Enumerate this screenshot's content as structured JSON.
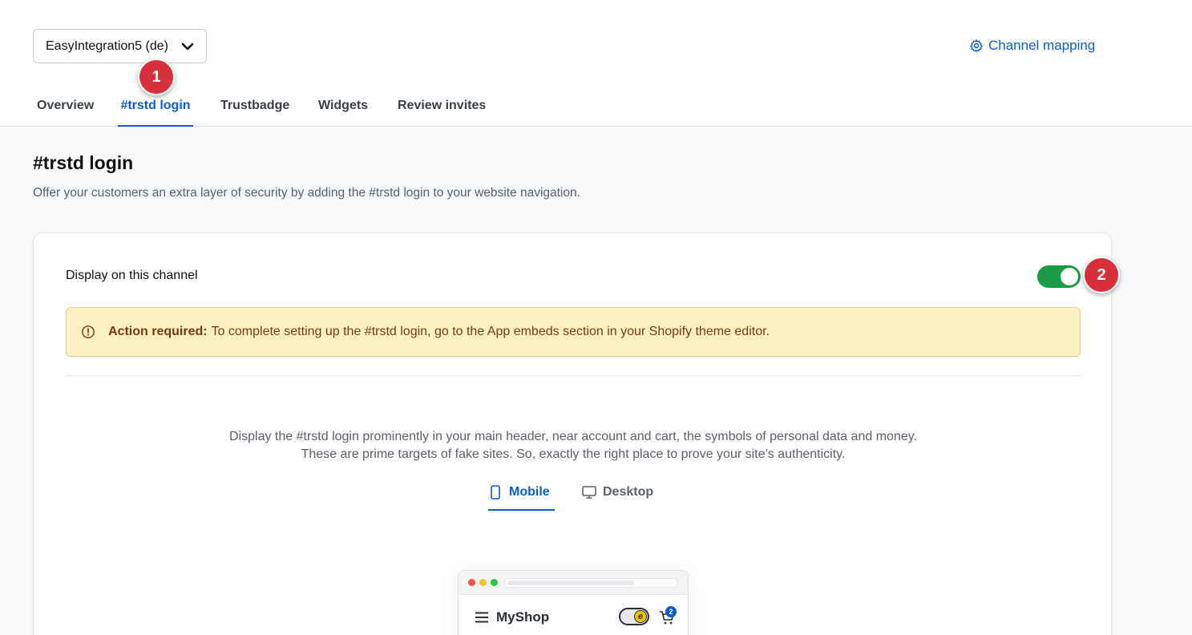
{
  "header": {
    "channel_selector": "EasyIntegration5 (de)",
    "channel_mapping": "Channel mapping"
  },
  "tabs": [
    {
      "label": "Overview"
    },
    {
      "label": "#trstd login"
    },
    {
      "label": "Trustbadge"
    },
    {
      "label": "Widgets"
    },
    {
      "label": "Review invites"
    }
  ],
  "active_tab": "#trstd login",
  "markers": [
    "1",
    "2"
  ],
  "page": {
    "title": "#trstd login",
    "description": "Offer your customers an extra layer of security by adding the #trstd login to your website navigation."
  },
  "card": {
    "display_label": "Display on this channel",
    "display_enabled": true,
    "alert_title": "Action required:",
    "alert_text": "To complete setting up the #trstd login, go to the App embeds section in your Shopify theme editor.",
    "info_line1": "Display the #trstd login prominently in your main header, near account and cart, the symbols of personal data and money.",
    "info_line2": "These are prime targets of fake sites. So, exactly the right place to prove your site’s authenticity.",
    "view_tabs": [
      {
        "label": "Mobile",
        "icon": "mobile-icon"
      },
      {
        "label": "Desktop",
        "icon": "desktop-icon"
      }
    ],
    "active_view": "Mobile"
  },
  "preview": {
    "shop_name": "MyShop",
    "badge_letter": "e",
    "cart_count": "2"
  },
  "colors": {
    "accent": "#0b5cd5",
    "toggle_on": "#1a9c46",
    "marker": "#d8303a",
    "alert_bg": "#fdf1c4",
    "alert_text": "#7a3a0a"
  }
}
